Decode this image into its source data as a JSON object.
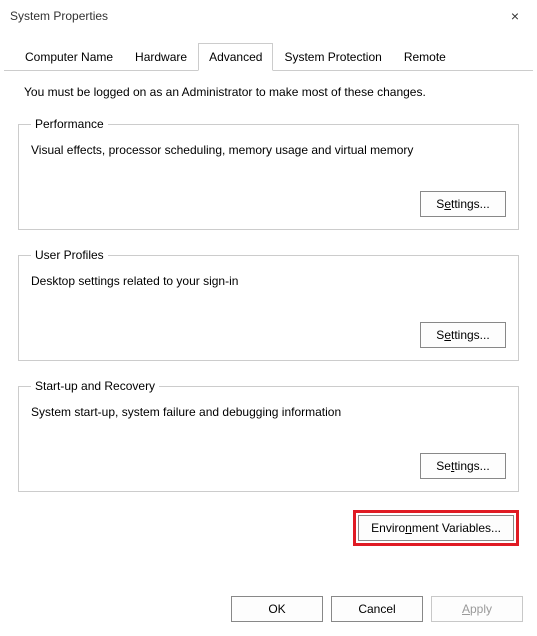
{
  "window": {
    "title": "System Properties",
    "close_label": "×"
  },
  "tabs": [
    {
      "id": "computer-name",
      "label": "Computer Name",
      "active": false
    },
    {
      "id": "hardware",
      "label": "Hardware",
      "active": false
    },
    {
      "id": "advanced",
      "label": "Advanced",
      "active": true
    },
    {
      "id": "system-protection",
      "label": "System Protection",
      "active": false
    },
    {
      "id": "remote",
      "label": "Remote",
      "active": false
    }
  ],
  "advanced_page": {
    "intro": "You must be logged on as an Administrator to make most of these changes.",
    "performance": {
      "legend": "Performance",
      "desc": "Visual effects, processor scheduling, memory usage and virtual memory",
      "settings_btn_pre": "S",
      "settings_btn_u": "e",
      "settings_btn_post": "ttings..."
    },
    "user_profiles": {
      "legend": "User Profiles",
      "desc": "Desktop settings related to your sign-in",
      "settings_btn_pre": "S",
      "settings_btn_u": "e",
      "settings_btn_post": "ttings..."
    },
    "startup_recovery": {
      "legend": "Start-up and Recovery",
      "desc": "System start-up, system failure and debugging information",
      "settings_btn_pre": "Se",
      "settings_btn_u": "t",
      "settings_btn_post": "tings..."
    },
    "env_btn_pre": "Enviro",
    "env_btn_u": "n",
    "env_btn_post": "ment Variables..."
  },
  "bottom": {
    "ok": "OK",
    "cancel": "Cancel",
    "apply_u": "A",
    "apply_post": "pply"
  }
}
